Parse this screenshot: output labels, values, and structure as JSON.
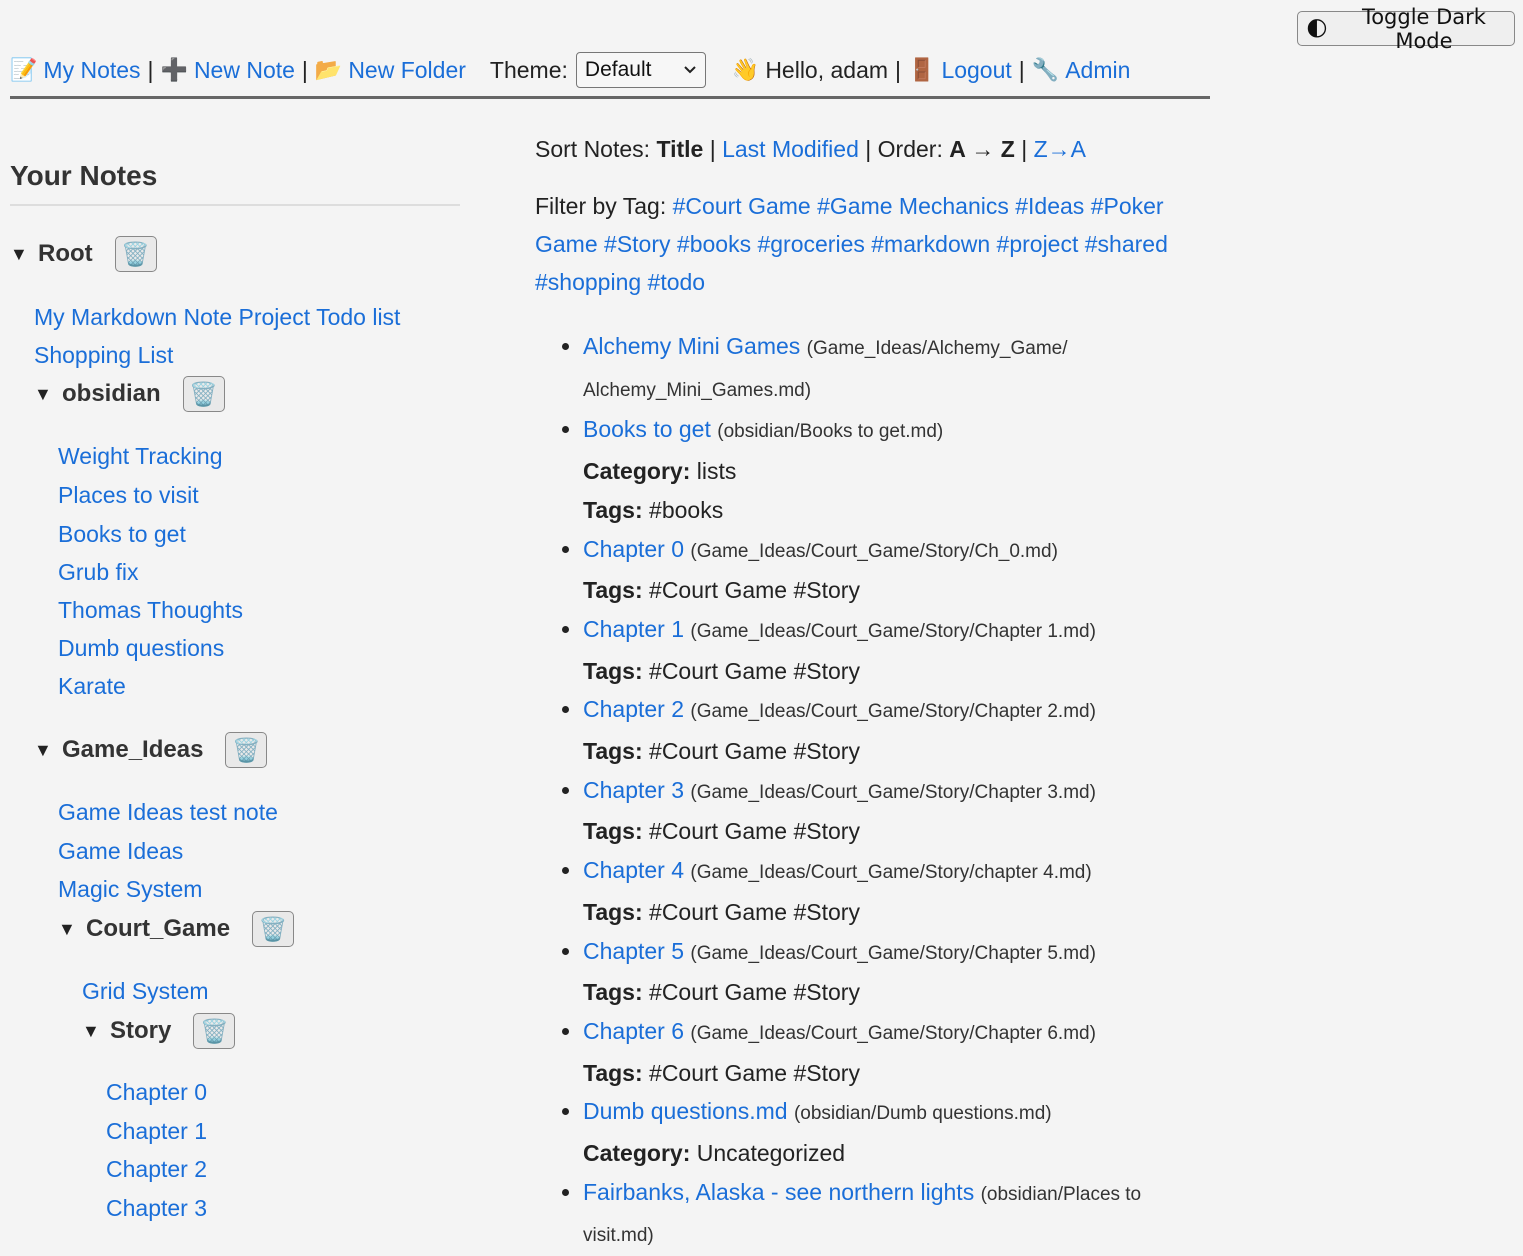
{
  "toggle": {
    "icon": "🌓",
    "label": "Toggle Dark Mode"
  },
  "nav": {
    "my_notes_icon": "📝",
    "my_notes": "My Notes",
    "new_note_icon": "➕",
    "new_note": "New Note",
    "new_folder_icon": "📂",
    "new_folder": "New Folder",
    "theme_label": "Theme:",
    "theme_value": "Default",
    "hello_icon": "👋",
    "hello": "Hello, adam",
    "logout_icon": "🚪",
    "logout": "Logout",
    "admin_icon": "🔧",
    "admin": "Admin",
    "sep": "|"
  },
  "sidebar": {
    "title": "Your Notes",
    "tri": "▼",
    "trash_icon": "🗑️",
    "root": "Root",
    "root_notes": [
      "My Markdown Note Project Todo list",
      "Shopping List"
    ],
    "obsidian": "obsidian",
    "obsidian_notes": [
      "Weight Tracking",
      "Places to visit",
      "Books to get",
      "Grub fix",
      "Thomas Thoughts",
      "Dumb questions",
      "Karate"
    ],
    "game_ideas": "Game_Ideas",
    "game_ideas_notes": [
      "Game Ideas test note",
      "Game Ideas",
      "Magic System"
    ],
    "court_game": "Court_Game",
    "court_game_notes": [
      "Grid System"
    ],
    "story": "Story",
    "story_notes": [
      "Chapter 0",
      "Chapter 1",
      "Chapter 2",
      "Chapter 3"
    ]
  },
  "sort": {
    "label": "Sort Notes:",
    "title": "Title",
    "sep": "|",
    "last_modified": "Last Modified",
    "order_label": "| Order:",
    "az": "A → Z",
    "za": "Z→A"
  },
  "filter": {
    "label": "Filter by Tag:",
    "tags": [
      "#Court Game",
      "#Game Mechanics",
      "#Ideas",
      "#Poker Game",
      "#Story",
      "#books",
      "#groceries",
      "#markdown",
      "#project",
      "#shared",
      "#shopping",
      "#todo"
    ]
  },
  "meta_labels": {
    "category": "Category:",
    "tags": "Tags:"
  },
  "notes": [
    {
      "title": "Alchemy Mini Games",
      "path": "(Game_Ideas/Alchemy_Game/ Alchemy_Mini_Games.md)"
    },
    {
      "title": "Books to get",
      "path": "(obsidian/Books to get.md)",
      "category": "lists",
      "tags": "#books"
    },
    {
      "title": "Chapter 0",
      "path": "(Game_Ideas/Court_Game/Story/Ch_0.md)",
      "tags": "#Court Game #Story"
    },
    {
      "title": "Chapter 1",
      "path": "(Game_Ideas/Court_Game/Story/Chapter 1.md)",
      "tags": "#Court Game #Story"
    },
    {
      "title": "Chapter 2",
      "path": "(Game_Ideas/Court_Game/Story/Chapter 2.md)",
      "tags": "#Court Game #Story"
    },
    {
      "title": "Chapter 3",
      "path": "(Game_Ideas/Court_Game/Story/Chapter 3.md)",
      "tags": "#Court Game #Story"
    },
    {
      "title": "Chapter 4",
      "path": "(Game_Ideas/Court_Game/Story/chapter 4.md)",
      "tags": "#Court Game #Story"
    },
    {
      "title": "Chapter 5",
      "path": "(Game_Ideas/Court_Game/Story/Chapter 5.md)",
      "tags": "#Court Game #Story"
    },
    {
      "title": "Chapter 6",
      "path": "(Game_Ideas/Court_Game/Story/Chapter 6.md)",
      "tags": "#Court Game #Story"
    },
    {
      "title": "Dumb questions.md",
      "path": "(obsidian/Dumb questions.md)",
      "category": "Uncategorized"
    },
    {
      "title": "Fairbanks, Alaska - see northern lights",
      "path": "(obsidian/Places to visit.md)"
    }
  ]
}
